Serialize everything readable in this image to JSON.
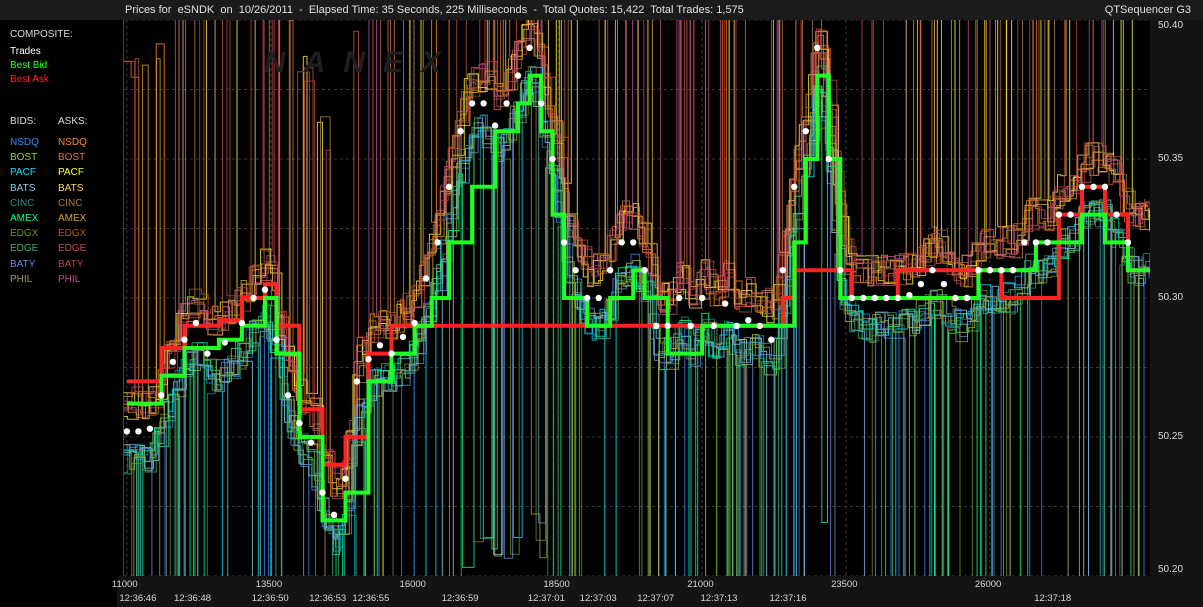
{
  "header": {
    "title": "Prices for  eSNDK  on  10/26/2011  -  Elapsed Time: 35 Seconds, 225 Milliseconds  -  Total Quotes: 15,422  Total Trades: 1,575",
    "app_name": "QTSequencer G3"
  },
  "watermark": "NANEX",
  "legend": {
    "composite_label": "COMPOSITE:",
    "composite": [
      {
        "label": "Trades",
        "color": "#ffffff"
      },
      {
        "label": "Best Bid",
        "color": "#22ff22"
      },
      {
        "label": "Best Ask",
        "color": "#ff2222"
      }
    ],
    "bids_header": "BIDS:",
    "asks_header": "ASKS:",
    "bids": [
      {
        "label": "NSDQ",
        "color": "#2f8cff"
      },
      {
        "label": "BOST",
        "color": "#9acd32"
      },
      {
        "label": "PACF",
        "color": "#00e5ff"
      },
      {
        "label": "BATS",
        "color": "#87ceeb"
      },
      {
        "label": "CINC",
        "color": "#2e8b8b"
      },
      {
        "label": "AMEX",
        "color": "#00ff7f"
      },
      {
        "label": "EDGX",
        "color": "#6b8e23"
      },
      {
        "label": "EDGE",
        "color": "#3cb371"
      },
      {
        "label": "BATY",
        "color": "#6a8fd8"
      },
      {
        "label": "PHIL",
        "color": "#a0a050"
      }
    ],
    "asks": [
      {
        "label": "NSDQ",
        "color": "#ff8c1a"
      },
      {
        "label": "BOST",
        "color": "#e07040"
      },
      {
        "label": "PACF",
        "color": "#ffff33"
      },
      {
        "label": "BATS",
        "color": "#ffd070"
      },
      {
        "label": "CINC",
        "color": "#b07850"
      },
      {
        "label": "AMEX",
        "color": "#d4a020"
      },
      {
        "label": "EDGX",
        "color": "#b05a30"
      },
      {
        "label": "EDGE",
        "color": "#c85050"
      },
      {
        "label": "BATY",
        "color": "#c04040"
      },
      {
        "label": "PHIL",
        "color": "#c04a8a"
      }
    ]
  },
  "chart_data": {
    "type": "line",
    "ylim": [
      50.2,
      50.4
    ],
    "y_ticks": [
      "50.40",
      "50.35",
      "50.30",
      "50.25",
      "50.20"
    ],
    "y_tick_values": [
      50.4,
      50.35,
      50.3,
      50.25,
      50.2
    ],
    "x_ticks": [
      {
        "label": "11000",
        "seq": 11000
      },
      {
        "label": "13500",
        "seq": 13500
      },
      {
        "label": "16000",
        "seq": 16000
      },
      {
        "label": "18500",
        "seq": 18500
      },
      {
        "label": "21000",
        "seq": 21000
      },
      {
        "label": "23500",
        "seq": 23500
      },
      {
        "label": "26000",
        "seq": 26000
      }
    ],
    "xlim": [
      10950,
      28800
    ],
    "time_labels": [
      {
        "label": "12:36:46",
        "seq": 11200
      },
      {
        "label": "12:36:48",
        "seq": 12150
      },
      {
        "label": "12:36:50",
        "seq": 13500
      },
      {
        "label": "12:36:53",
        "seq": 14500
      },
      {
        "label": "12:36:55",
        "seq": 15250
      },
      {
        "label": "12:36:59",
        "seq": 16800
      },
      {
        "label": "12:37:01",
        "seq": 18300
      },
      {
        "label": "12:37:03",
        "seq": 19200
      },
      {
        "label": "12:37:07",
        "seq": 20200
      },
      {
        "label": "12:37:13",
        "seq": 21300
      },
      {
        "label": "12:37:16",
        "seq": 22500
      },
      {
        "label": "12:37:18",
        "seq": 27100
      }
    ],
    "trades": [
      [
        11000,
        50.252
      ],
      [
        11200,
        50.252
      ],
      [
        11400,
        50.253
      ],
      [
        11600,
        50.265
      ],
      [
        11800,
        50.277
      ],
      [
        12000,
        50.285
      ],
      [
        12200,
        50.291
      ],
      [
        12400,
        50.28
      ],
      [
        12700,
        50.284
      ],
      [
        13000,
        50.291
      ],
      [
        13200,
        50.3
      ],
      [
        13400,
        50.303
      ],
      [
        13600,
        50.285
      ],
      [
        13800,
        50.265
      ],
      [
        14000,
        50.255
      ],
      [
        14200,
        50.248
      ],
      [
        14400,
        50.23
      ],
      [
        14600,
        50.222
      ],
      [
        14800,
        50.235
      ],
      [
        15000,
        50.27
      ],
      [
        15200,
        50.278
      ],
      [
        15400,
        50.283
      ],
      [
        15600,
        50.28
      ],
      [
        15800,
        50.286
      ],
      [
        16000,
        50.291
      ],
      [
        16200,
        50.307
      ],
      [
        16400,
        50.32
      ],
      [
        16600,
        50.34
      ],
      [
        16800,
        50.36
      ],
      [
        17000,
        50.37
      ],
      [
        17200,
        50.37
      ],
      [
        17400,
        50.362
      ],
      [
        17600,
        50.37
      ],
      [
        17800,
        50.38
      ],
      [
        18000,
        50.39
      ],
      [
        18200,
        50.37
      ],
      [
        18400,
        50.35
      ],
      [
        18600,
        50.32
      ],
      [
        18800,
        50.31
      ],
      [
        19000,
        50.3
      ],
      [
        19200,
        50.3
      ],
      [
        19400,
        50.31
      ],
      [
        19600,
        50.32
      ],
      [
        19800,
        50.32
      ],
      [
        20000,
        50.31
      ],
      [
        20200,
        50.29
      ],
      [
        20400,
        50.29
      ],
      [
        20600,
        50.3
      ],
      [
        20800,
        50.29
      ],
      [
        21000,
        50.3
      ],
      [
        21200,
        50.29
      ],
      [
        21400,
        50.298
      ],
      [
        21600,
        50.29
      ],
      [
        21800,
        50.292
      ],
      [
        22000,
        50.29
      ],
      [
        22200,
        50.285
      ],
      [
        22400,
        50.31
      ],
      [
        22600,
        50.34
      ],
      [
        22800,
        50.36
      ],
      [
        23000,
        50.39
      ],
      [
        23200,
        50.35
      ],
      [
        23400,
        50.31
      ],
      [
        23600,
        50.3
      ],
      [
        23800,
        50.3
      ],
      [
        24000,
        50.3
      ],
      [
        24200,
        50.3
      ],
      [
        24400,
        50.3
      ],
      [
        24600,
        50.301
      ],
      [
        24800,
        50.305
      ],
      [
        25000,
        50.31
      ],
      [
        25200,
        50.305
      ],
      [
        25400,
        50.3
      ],
      [
        25600,
        50.3
      ],
      [
        25800,
        50.31
      ],
      [
        26000,
        50.31
      ],
      [
        26200,
        50.31
      ],
      [
        26400,
        50.31
      ],
      [
        26600,
        50.32
      ],
      [
        26800,
        50.32
      ],
      [
        27000,
        50.32
      ],
      [
        27200,
        50.33
      ],
      [
        27400,
        50.33
      ],
      [
        27600,
        50.34
      ],
      [
        27800,
        50.34
      ],
      [
        28000,
        50.34
      ],
      [
        28200,
        50.33
      ],
      [
        28400,
        50.32
      ]
    ],
    "best_bid": [
      [
        11000,
        50.262
      ],
      [
        11600,
        50.272
      ],
      [
        12000,
        50.282
      ],
      [
        12600,
        50.285
      ],
      [
        13000,
        50.29
      ],
      [
        13400,
        50.3
      ],
      [
        13600,
        50.28
      ],
      [
        14000,
        50.25
      ],
      [
        14400,
        50.22
      ],
      [
        14800,
        50.23
      ],
      [
        15200,
        50.27
      ],
      [
        15600,
        50.28
      ],
      [
        16000,
        50.29
      ],
      [
        16300,
        50.3
      ],
      [
        16600,
        50.32
      ],
      [
        17000,
        50.34
      ],
      [
        17400,
        50.36
      ],
      [
        17800,
        50.37
      ],
      [
        18000,
        50.38
      ],
      [
        18200,
        50.36
      ],
      [
        18400,
        50.33
      ],
      [
        18600,
        50.3
      ],
      [
        19000,
        50.29
      ],
      [
        19400,
        50.3
      ],
      [
        19800,
        50.31
      ],
      [
        20000,
        50.3
      ],
      [
        20400,
        50.28
      ],
      [
        21000,
        50.29
      ],
      [
        21600,
        50.29
      ],
      [
        22000,
        50.29
      ],
      [
        22400,
        50.29
      ],
      [
        22600,
        50.32
      ],
      [
        22800,
        50.35
      ],
      [
        23000,
        50.38
      ],
      [
        23200,
        50.35
      ],
      [
        23400,
        50.3
      ],
      [
        23600,
        50.3
      ],
      [
        24400,
        50.3
      ],
      [
        25000,
        50.3
      ],
      [
        25600,
        50.3
      ],
      [
        25800,
        50.31
      ],
      [
        26400,
        50.31
      ],
      [
        26800,
        50.32
      ],
      [
        27200,
        50.32
      ],
      [
        27600,
        50.33
      ],
      [
        28000,
        50.32
      ],
      [
        28400,
        50.31
      ]
    ],
    "best_ask": [
      [
        11000,
        50.27
      ],
      [
        11600,
        50.282
      ],
      [
        12000,
        50.29
      ],
      [
        12600,
        50.292
      ],
      [
        13000,
        50.3
      ],
      [
        13400,
        50.305
      ],
      [
        13600,
        50.29
      ],
      [
        14000,
        50.26
      ],
      [
        14400,
        50.24
      ],
      [
        14800,
        50.25
      ],
      [
        15200,
        50.28
      ],
      [
        15600,
        50.29
      ],
      [
        16000,
        50.29
      ],
      [
        16600,
        50.29
      ],
      [
        17600,
        50.29
      ],
      [
        18600,
        50.29
      ],
      [
        19600,
        50.29
      ],
      [
        20400,
        50.29
      ],
      [
        21000,
        50.29
      ],
      [
        21600,
        50.29
      ],
      [
        22000,
        50.29
      ],
      [
        22400,
        50.3
      ],
      [
        22600,
        50.31
      ],
      [
        23000,
        50.31
      ],
      [
        23400,
        50.31
      ],
      [
        23600,
        50.3
      ],
      [
        24400,
        50.31
      ],
      [
        25000,
        50.31
      ],
      [
        25600,
        50.31
      ],
      [
        26200,
        50.3
      ],
      [
        26800,
        50.3
      ],
      [
        27200,
        50.33
      ],
      [
        27600,
        50.34
      ],
      [
        28000,
        50.33
      ],
      [
        28400,
        50.31
      ]
    ]
  }
}
